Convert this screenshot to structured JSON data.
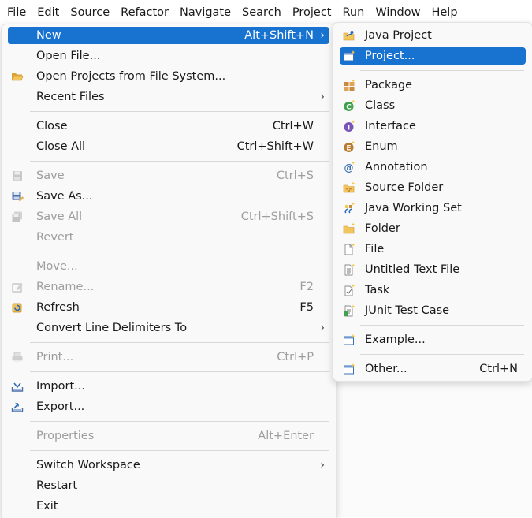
{
  "menubar": [
    "File",
    "Edit",
    "Source",
    "Refactor",
    "Navigate",
    "Search",
    "Project",
    "Run",
    "Window",
    "Help"
  ],
  "file_menu": {
    "new": {
      "label": "New",
      "accel": "Alt+Shift+N"
    },
    "open_file": {
      "label": "Open File..."
    },
    "open_projects": {
      "label": "Open Projects from File System..."
    },
    "recent_files": {
      "label": "Recent Files"
    },
    "close": {
      "label": "Close",
      "accel": "Ctrl+W"
    },
    "close_all": {
      "label": "Close All",
      "accel": "Ctrl+Shift+W"
    },
    "save": {
      "label": "Save",
      "accel": "Ctrl+S"
    },
    "save_as": {
      "label": "Save As..."
    },
    "save_all": {
      "label": "Save All",
      "accel": "Ctrl+Shift+S"
    },
    "revert": {
      "label": "Revert"
    },
    "move": {
      "label": "Move..."
    },
    "rename": {
      "label": "Rename...",
      "accel": "F2"
    },
    "refresh": {
      "label": "Refresh",
      "accel": "F5"
    },
    "convert_line_delimiters": {
      "label": "Convert Line Delimiters To"
    },
    "print": {
      "label": "Print...",
      "accel": "Ctrl+P"
    },
    "import": {
      "label": "Import..."
    },
    "export": {
      "label": "Export..."
    },
    "properties": {
      "label": "Properties",
      "accel": "Alt+Enter"
    },
    "switch_workspace": {
      "label": "Switch Workspace"
    },
    "restart": {
      "label": "Restart"
    },
    "exit": {
      "label": "Exit"
    }
  },
  "new_menu": {
    "java_project": {
      "label": "Java Project"
    },
    "project": {
      "label": "Project..."
    },
    "package": {
      "label": "Package"
    },
    "class": {
      "label": "Class"
    },
    "interface": {
      "label": "Interface"
    },
    "enum": {
      "label": "Enum"
    },
    "annotation": {
      "label": "Annotation"
    },
    "source_folder": {
      "label": "Source Folder"
    },
    "java_working_set": {
      "label": "Java Working Set"
    },
    "folder": {
      "label": "Folder"
    },
    "file": {
      "label": "File"
    },
    "untitled_text_file": {
      "label": "Untitled Text File"
    },
    "task": {
      "label": "Task"
    },
    "junit_test_case": {
      "label": "JUnit Test Case"
    },
    "example": {
      "label": "Example..."
    },
    "other": {
      "label": "Other...",
      "accel": "Ctrl+N"
    }
  },
  "icons": {
    "open_projects": "folder-open-icon",
    "save": "save-icon",
    "save_as": "save-as-icon",
    "save_all": "save-all-icon",
    "rename": "rename-icon",
    "refresh": "refresh-icon",
    "print": "print-icon",
    "import": "import-icon",
    "export": "export-icon"
  },
  "colors": {
    "selection": "#1772d0",
    "menu_bg": "#f9f9f9",
    "disabled_text": "#9e9e9e"
  }
}
